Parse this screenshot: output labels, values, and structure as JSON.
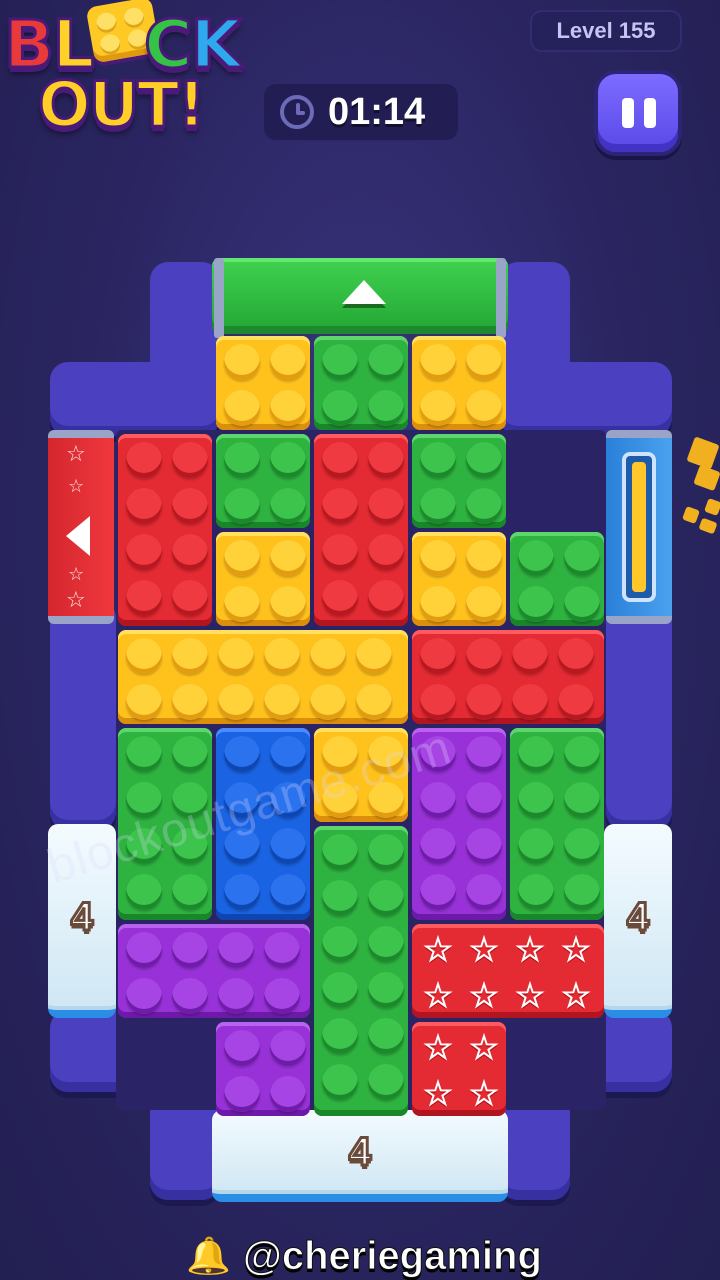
{
  "header": {
    "logo_line1": [
      "B",
      "L",
      "O",
      "C",
      "K"
    ],
    "logo_line2": "OUT!",
    "level_label": "Level 155",
    "timer": "01:14",
    "pause_icon": "pause-icon",
    "clock_icon": "clock-icon"
  },
  "board": {
    "ice_left_count": "4",
    "ice_right_count": "4",
    "ice_bottom_count": "4",
    "gate_top_color": "#2fb340",
    "gate_left_color": "#e42a32",
    "gate_right_color": "#1a63e2",
    "blocks": [
      {
        "color": "yellow",
        "cells": [
          [
            0,
            0
          ],
          [
            0,
            1
          ],
          [
            1,
            0
          ],
          [
            1,
            1
          ]
        ],
        "area": "top-left"
      },
      {
        "color": "green",
        "area": "top-mid"
      },
      {
        "color": "yellow",
        "area": "top-right"
      },
      {
        "color": "red",
        "area": "left-tall"
      },
      {
        "color": "green",
        "area": "mid"
      },
      {
        "color": "red",
        "area": "mid-tall"
      },
      {
        "color": "green",
        "area": "right"
      },
      {
        "color": "yellow",
        "area": "T-shape"
      },
      {
        "color": "yellow",
        "area": "right-small"
      },
      {
        "color": "green",
        "area": "far-right"
      },
      {
        "color": "red",
        "area": "wide-right"
      },
      {
        "color": "green",
        "area": "lower-left"
      },
      {
        "color": "blue",
        "area": "lower-mid"
      },
      {
        "color": "yellow",
        "area": "lower-small"
      },
      {
        "color": "purple",
        "area": "lower-right"
      },
      {
        "color": "green",
        "area": "lower-far-right"
      },
      {
        "color": "green",
        "area": "bottom-tall"
      },
      {
        "color": "purple",
        "area": "bottom-left"
      },
      {
        "color": "red",
        "area": "star-block",
        "pattern": "stars"
      }
    ]
  },
  "watermark": "blockoutgame.com",
  "credit": {
    "icon": "bell-icon",
    "handle": "@cheriegaming"
  }
}
